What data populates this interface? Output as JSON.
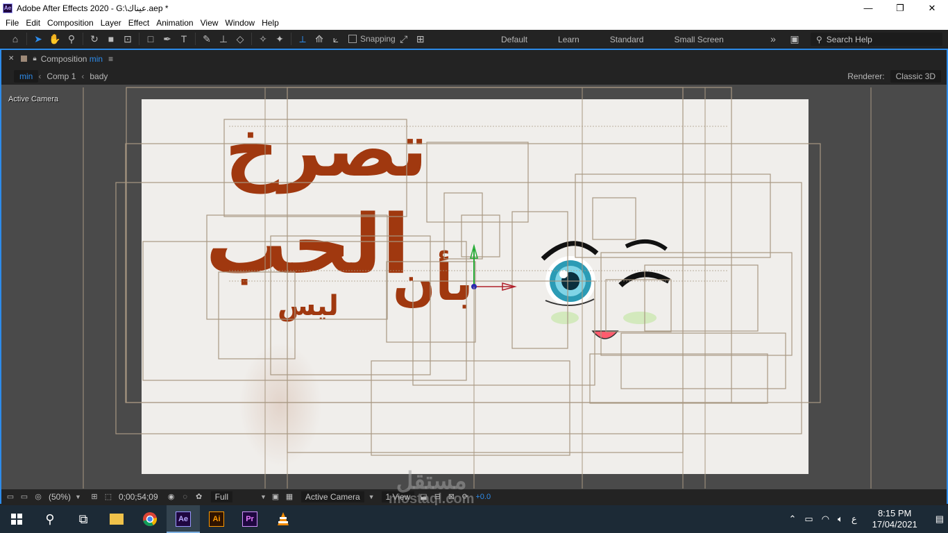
{
  "window": {
    "title": "Adobe After Effects 2020 - G:\\عيناك.aep *",
    "app_badge": "Ae",
    "controls": [
      "—",
      "❐",
      "✕"
    ]
  },
  "menu": [
    "File",
    "Edit",
    "Composition",
    "Layer",
    "Effect",
    "Animation",
    "View",
    "Window",
    "Help"
  ],
  "toolbar": {
    "snapping_label": "Snapping",
    "workspaces": [
      "Default",
      "Learn",
      "Standard",
      "Small Screen"
    ],
    "search_placeholder": "Search Help"
  },
  "panel": {
    "title_prefix": "Composition",
    "comp_name": "min",
    "breadcrumbs": [
      "min",
      "Comp 1",
      "bady"
    ],
    "renderer_label": "Renderer:",
    "renderer_value": "Classic 3D",
    "view_label": "Active Camera"
  },
  "canvas_text": {
    "line1": "تصرخ",
    "line2": "الحب",
    "line3": "بأن",
    "line4": "ليس"
  },
  "footer": {
    "magnification": "(50%)",
    "timecode": "0;00;54;09",
    "resolution": "Full",
    "camera": "Active Camera",
    "views": "1 View",
    "exposure": "+0.0"
  },
  "taskbar": {
    "apps": [
      "windows-start",
      "search",
      "task-view",
      "file-explorer",
      "chrome",
      "Ae",
      "Ai",
      "Pr",
      "vlc"
    ],
    "language": "ع",
    "time": "8:15 PM",
    "date": "17/04/2021"
  },
  "watermark": {
    "arabic": "مستقل",
    "latin": "mostaql.com"
  },
  "colors": {
    "accent": "#2d8ceb",
    "text_red": "#a0380f",
    "canvas_bg": "#f0eeeb",
    "panel_bg": "#4a4a4a"
  }
}
